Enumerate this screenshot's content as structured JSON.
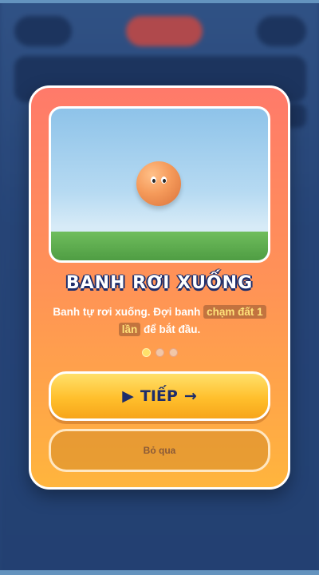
{
  "modal": {
    "title": "BANH RƠI XUỐNG",
    "description": {
      "part1": "Banh tự rơi xuống. Đợi banh",
      "highlight1": "chạm đất 1",
      "highlight2": "lần",
      "part2": "để bắt đầu."
    },
    "pagination": {
      "total": 3,
      "active_index": 0
    },
    "next_button": {
      "play_icon": "▶",
      "label": "TIẾP",
      "arrow": "→"
    },
    "skip_button": {
      "label": "Bỏ qua"
    }
  },
  "colors": {
    "card_top": "#ff7a6a",
    "card_bottom": "#ffb53d",
    "title_outline": "#1d2d6b",
    "highlight_text": "#ffe27a",
    "next_button": "#ffbf2c",
    "background": "#2d4f86"
  }
}
